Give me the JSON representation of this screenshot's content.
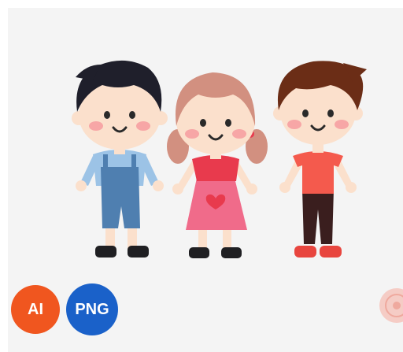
{
  "badges": {
    "ai": "AI",
    "png": "PNG"
  },
  "colors": {
    "background": "#f4f4f4",
    "ai_badge": "#f0561f",
    "png_badge": "#1a61c9",
    "skin": "#fbe0cc",
    "cheek": "#f7a6a6",
    "boy1_hair": "#1f1f2b",
    "boy1_shirt": "#9cc3e6",
    "boy1_overalls": "#4f7fb0",
    "girl_hair": "#d29080",
    "girl_dress": "#f06b8a",
    "girl_bodice": "#e83a4d",
    "boy2_hair": "#6b2d16",
    "boy2_shirt": "#f45a4d",
    "boy2_pants": "#3a1e1e",
    "shoes_dark": "#1f1f22",
    "shoes_red": "#e8453e"
  },
  "icons": {
    "watermark": "logo-stamp-icon"
  }
}
